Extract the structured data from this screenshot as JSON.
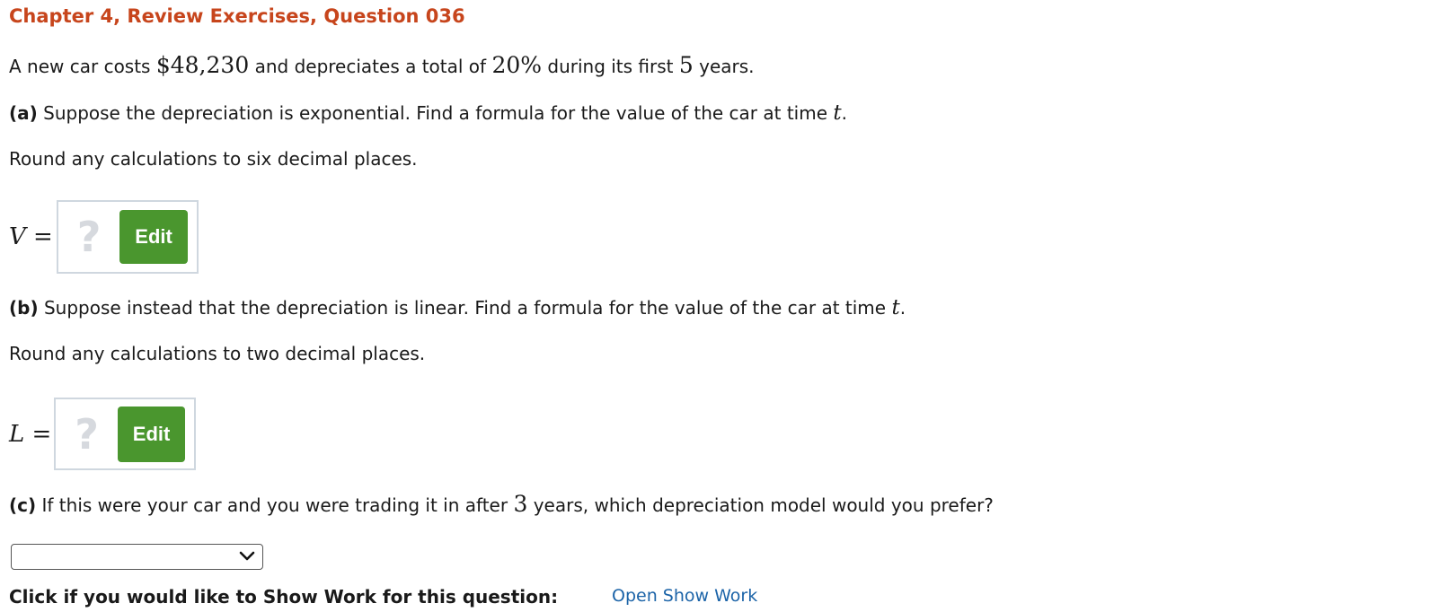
{
  "header": {
    "title": "Chapter 4, Review Exercises, Question 036"
  },
  "intro": {
    "p1": "A new car costs ",
    "price": "$48,230",
    "p2": " and depreciates a total of ",
    "percent": "20%",
    "p3": " during its first ",
    "years": "5",
    "p4": " years."
  },
  "part_a": {
    "label": "(a)",
    "text": " Suppose the depreciation is exponential. Find a formula for the value of the car at time ",
    "var": "t",
    "end": ".",
    "instruction": "Round any calculations to six decimal places.",
    "answer_var": "V",
    "equals": " =",
    "placeholder": "?",
    "edit_label": "Edit"
  },
  "part_b": {
    "label": "(b)",
    "text": " Suppose instead that the depreciation is linear. Find a formula for the value of the car at time ",
    "var": "t",
    "end": ".",
    "instruction": "Round any calculations to two decimal places.",
    "answer_var": "L",
    "equals": " =",
    "placeholder": "?",
    "edit_label": "Edit"
  },
  "part_c": {
    "label": "(c)",
    "text1": " If this were your car and you were trading it in after ",
    "years": "3",
    "text2": " years, which depreciation model would you prefer?",
    "selected_value": ""
  },
  "footer": {
    "show_work_prompt": "Click if you would like to Show Work for this question:",
    "show_work_link": "Open Show Work"
  },
  "colors": {
    "title": "#c7451c",
    "edit_button": "#4a962e",
    "link": "#1c64a8",
    "answer_border": "#cfd7df",
    "placeholder": "#d6d9de"
  }
}
